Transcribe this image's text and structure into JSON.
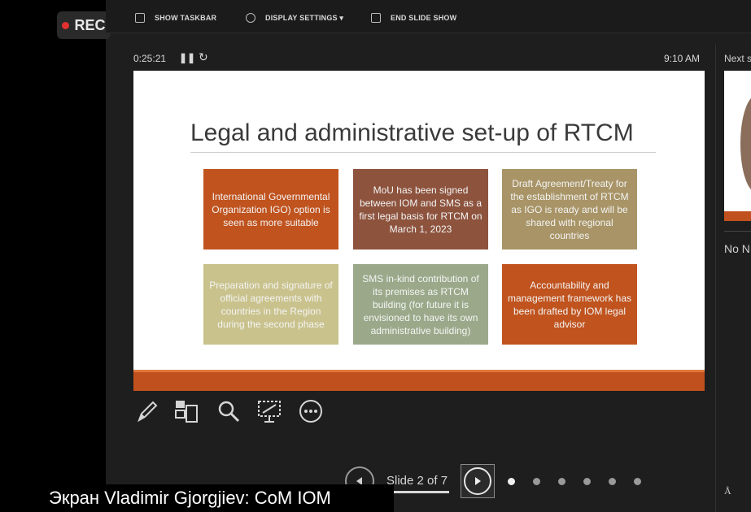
{
  "recording": {
    "label": "REC"
  },
  "toolbar": {
    "show_taskbar": "SHOW TASKBAR",
    "display_settings": "DISPLAY SETTINGS ▾",
    "end_slide_show": "END SLIDE SHOW"
  },
  "presenter": {
    "timer": "0:25:21",
    "clock": "9:10 AM",
    "next_label": "Next s",
    "notes": "No N"
  },
  "slide": {
    "title": "Legal and administrative set-up of RTCM",
    "boxes": [
      {
        "text": "International Governmental Organization IGO) option is seen as more suitable",
        "color": "#c0531e"
      },
      {
        "text": "MoU has been signed between IOM and SMS as a first legal basis for RTCM on March 1, 2023",
        "color": "#8d533d"
      },
      {
        "text": "Draft Agreement/Treaty for the establishment of RTCM as IGO is ready and will be shared with regional countries",
        "color": "#a89466"
      },
      {
        "text": "Preparation and signature of official agreements with countries in the Region during the second phase",
        "color": "#c9c28c"
      },
      {
        "text": "SMS in-kind contribution of its premises as RTCM building (for future it is envisioned to have its own administrative building)",
        "color": "#9ba98a"
      },
      {
        "text": "Accountability and management framework has been drafted by IOM legal advisor",
        "color": "#c0531e"
      }
    ]
  },
  "navigation": {
    "slide_counter": "Slide 2 of 7",
    "current_slide": 2,
    "total_slides": 7
  },
  "tools": [
    "pen-icon",
    "slides-grid-icon",
    "zoom-icon",
    "pointer-screen-icon",
    "more-options-icon"
  ],
  "caption": {
    "text": "Экран Vladimir Gjorgjiev: CoM IOM"
  },
  "colors": {
    "accent": "#c0501e",
    "background": "#1e1e1e"
  }
}
